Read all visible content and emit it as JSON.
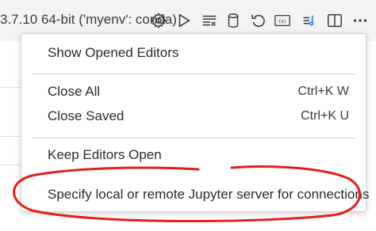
{
  "toolbar": {
    "kernel_label": "3.7.10 64-bit ('myenv': conda)",
    "icons": [
      "gear-icon",
      "run-icon",
      "clear-outputs-icon",
      "database-icon",
      "restart-icon",
      "variables-icon",
      "outline-icon",
      "split-editor-icon",
      "more-icon"
    ]
  },
  "menu": {
    "items": [
      {
        "label": "Show Opened Editors",
        "shortcut": ""
      },
      {
        "label": "Close All",
        "shortcut": "Ctrl+K W"
      },
      {
        "label": "Close Saved",
        "shortcut": "Ctrl+K U"
      },
      {
        "label": "Keep Editors Open",
        "shortcut": ""
      },
      {
        "label": "Specify local or remote Jupyter server for connections",
        "shortcut": ""
      }
    ]
  },
  "colors": {
    "toolbar_bg": "#f3f3f3",
    "menu_bg": "#ffffff",
    "annotation": "#e0201a"
  }
}
